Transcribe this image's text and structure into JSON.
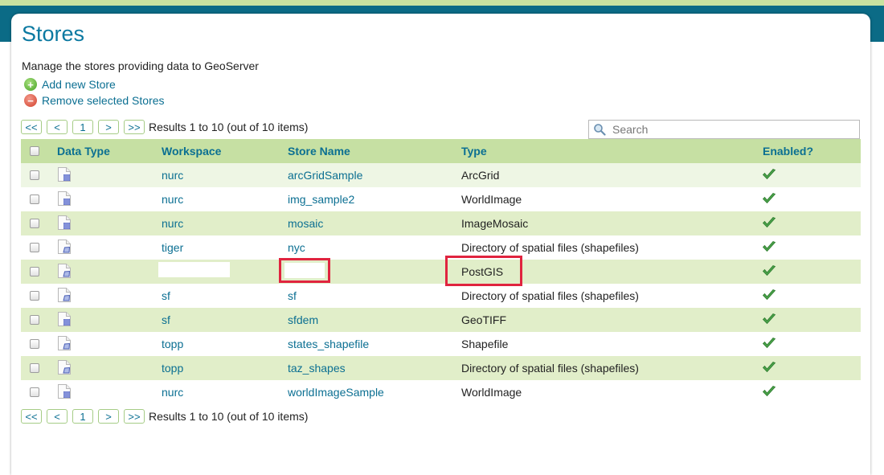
{
  "page": {
    "title": "Stores",
    "description": "Manage the stores providing data to GeoServer",
    "add_label": "Add new Store",
    "remove_label": "Remove selected Stores"
  },
  "pager": {
    "first": "<<",
    "prev": "<",
    "page": "1",
    "next": ">",
    "last": ">>",
    "results": "Results 1 to 10 (out of 10 items)"
  },
  "search": {
    "placeholder": "Search"
  },
  "table": {
    "headers": {
      "data_type": "Data Type",
      "workspace": "Workspace",
      "store_name": "Store Name",
      "type": "Type",
      "enabled": "Enabled?"
    },
    "rows": [
      {
        "icon": "raster-icon",
        "workspace": "nurc",
        "store_name": "arcGridSample",
        "type": "ArcGrid",
        "enabled": true
      },
      {
        "icon": "raster-icon",
        "workspace": "nurc",
        "store_name": "img_sample2",
        "type": "WorldImage",
        "enabled": true
      },
      {
        "icon": "raster-icon",
        "workspace": "nurc",
        "store_name": "mosaic",
        "type": "ImageMosaic",
        "enabled": true
      },
      {
        "icon": "vector-icon",
        "workspace": "tiger",
        "store_name": "nyc",
        "type": "Directory of spatial files (shapefiles)",
        "enabled": true
      },
      {
        "icon": "vector-icon",
        "workspace": "",
        "store_name": "",
        "type": "PostGIS",
        "enabled": true
      },
      {
        "icon": "vector-icon",
        "workspace": "sf",
        "store_name": "sf",
        "type": "Directory of spatial files (shapefiles)",
        "enabled": true
      },
      {
        "icon": "raster-icon",
        "workspace": "sf",
        "store_name": "sfdem",
        "type": "GeoTIFF",
        "enabled": true
      },
      {
        "icon": "vector-icon",
        "workspace": "topp",
        "store_name": "states_shapefile",
        "type": "Shapefile",
        "enabled": true
      },
      {
        "icon": "vector-icon",
        "workspace": "topp",
        "store_name": "taz_shapes",
        "type": "Directory of spatial files (shapefiles)",
        "enabled": true
      },
      {
        "icon": "raster-icon",
        "workspace": "nurc",
        "store_name": "worldImageSample",
        "type": "WorldImage",
        "enabled": true
      }
    ]
  },
  "colors": {
    "accent": "#0b6f92",
    "header_bg": "#c6e0a3",
    "highlight": "#e0243f",
    "check": "#4aa14a"
  }
}
